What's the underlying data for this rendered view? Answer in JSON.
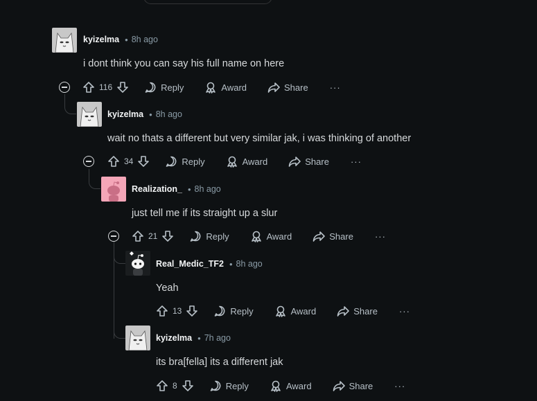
{
  "comments": [
    {
      "author": "kyizelma",
      "time": "8h ago",
      "body": "i dont think you can say his full name on here",
      "score": "116",
      "avatar": "cat"
    },
    {
      "author": "kyizelma",
      "time": "8h ago",
      "body": "wait no thats a different but very similar jak, i was thinking of another",
      "score": "34",
      "avatar": "cat"
    },
    {
      "author": "Realization_",
      "time": "8h ago",
      "body": "just tell me if its straight up a slur",
      "score": "21",
      "avatar": "snoo-pink"
    },
    {
      "author": "Real_Medic_TF2",
      "time": "8h ago",
      "body": "Yeah",
      "score": "13",
      "avatar": "snoo-dark"
    },
    {
      "author": "kyizelma",
      "time": "7h ago",
      "body": "its bra[fella] its a different jak",
      "score": "8",
      "avatar": "cat"
    }
  ],
  "actions": {
    "reply": "Reply",
    "award": "Award",
    "share": "Share",
    "more": "···",
    "separator": "•"
  },
  "icons": [
    "upvote-icon",
    "downvote-icon",
    "reply-icon",
    "award-icon",
    "share-icon",
    "more-icon",
    "collapse-icon"
  ],
  "colors": {
    "background": "#0e1113",
    "text": "#d7dadc",
    "muted": "#8a9ba6",
    "thread_line": "#3a3d40"
  }
}
